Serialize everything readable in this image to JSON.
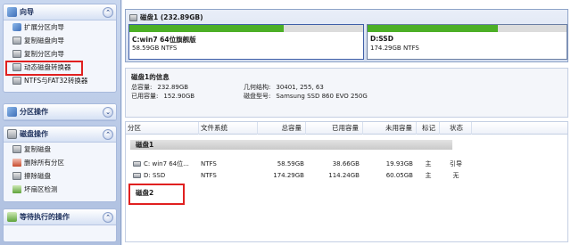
{
  "sidebar": {
    "wizard": {
      "title": "向导",
      "items": [
        {
          "label": "扩展分区向导",
          "icon": "expand-partition-icon"
        },
        {
          "label": "复制磁盘向导",
          "icon": "copy-disk-icon"
        },
        {
          "label": "复制分区向导",
          "icon": "copy-partition-icon"
        },
        {
          "label": "动态磁盘转换器",
          "icon": "dynamic-disk-converter-icon"
        },
        {
          "label": "NTFS与FAT32转换器",
          "icon": "ntfs-fat32-converter-icon"
        }
      ]
    },
    "partition_ops": {
      "title": "分区操作"
    },
    "disk_ops": {
      "title": "磁盘操作",
      "items": [
        {
          "label": "复制磁盘",
          "icon": "copy-disk-icon"
        },
        {
          "label": "删除所有分区",
          "icon": "delete-partitions-icon"
        },
        {
          "label": "擦除磁盘",
          "icon": "wipe-disk-icon"
        },
        {
          "label": "坏扇区检测",
          "icon": "bad-sector-icon"
        }
      ]
    },
    "pending_ops": {
      "title": "等待执行的操作"
    }
  },
  "diskbar": {
    "title": "磁盘1 (232.89GB)",
    "segments": [
      {
        "name": "C:win7 64位旗舰版",
        "detail": "58.59GB NTFS",
        "used_fraction": 0.66,
        "color": "#4caf26"
      },
      {
        "name": "D:SSD",
        "detail": "174.29GB NTFS",
        "used_fraction": 0.655,
        "color": "#4caf26"
      }
    ]
  },
  "info": {
    "title": "磁盘1的信息",
    "total_label": "总容量:",
    "total_value": "232.89GB",
    "used_label": "已用容量:",
    "used_value": "152.90GB",
    "geometry_label": "几何结构:",
    "geometry_value": "30401, 255, 63",
    "model_label": "磁盘型号:",
    "model_value": "Samsung SSD 860 EVO 250G"
  },
  "table": {
    "headers": [
      "分区",
      "文件系统",
      "总容量",
      "已用容量",
      "未用容量",
      "标记",
      "状态"
    ],
    "groups": [
      {
        "label": "磁盘1",
        "rows": [
          {
            "partition": "C: win7 64位...",
            "fs": "NTFS",
            "total": "58.59GB",
            "used": "38.66GB",
            "free": "19.93GB",
            "flag": "主",
            "status": "引导"
          },
          {
            "partition": "D: SSD",
            "fs": "NTFS",
            "total": "174.29GB",
            "used": "114.24GB",
            "free": "60.05GB",
            "flag": "主",
            "status": "无"
          }
        ]
      },
      {
        "label": "磁盘2",
        "rows": []
      }
    ]
  },
  "colors": {
    "highlight_box": "#e02020",
    "used_fill": "#4caf26"
  }
}
